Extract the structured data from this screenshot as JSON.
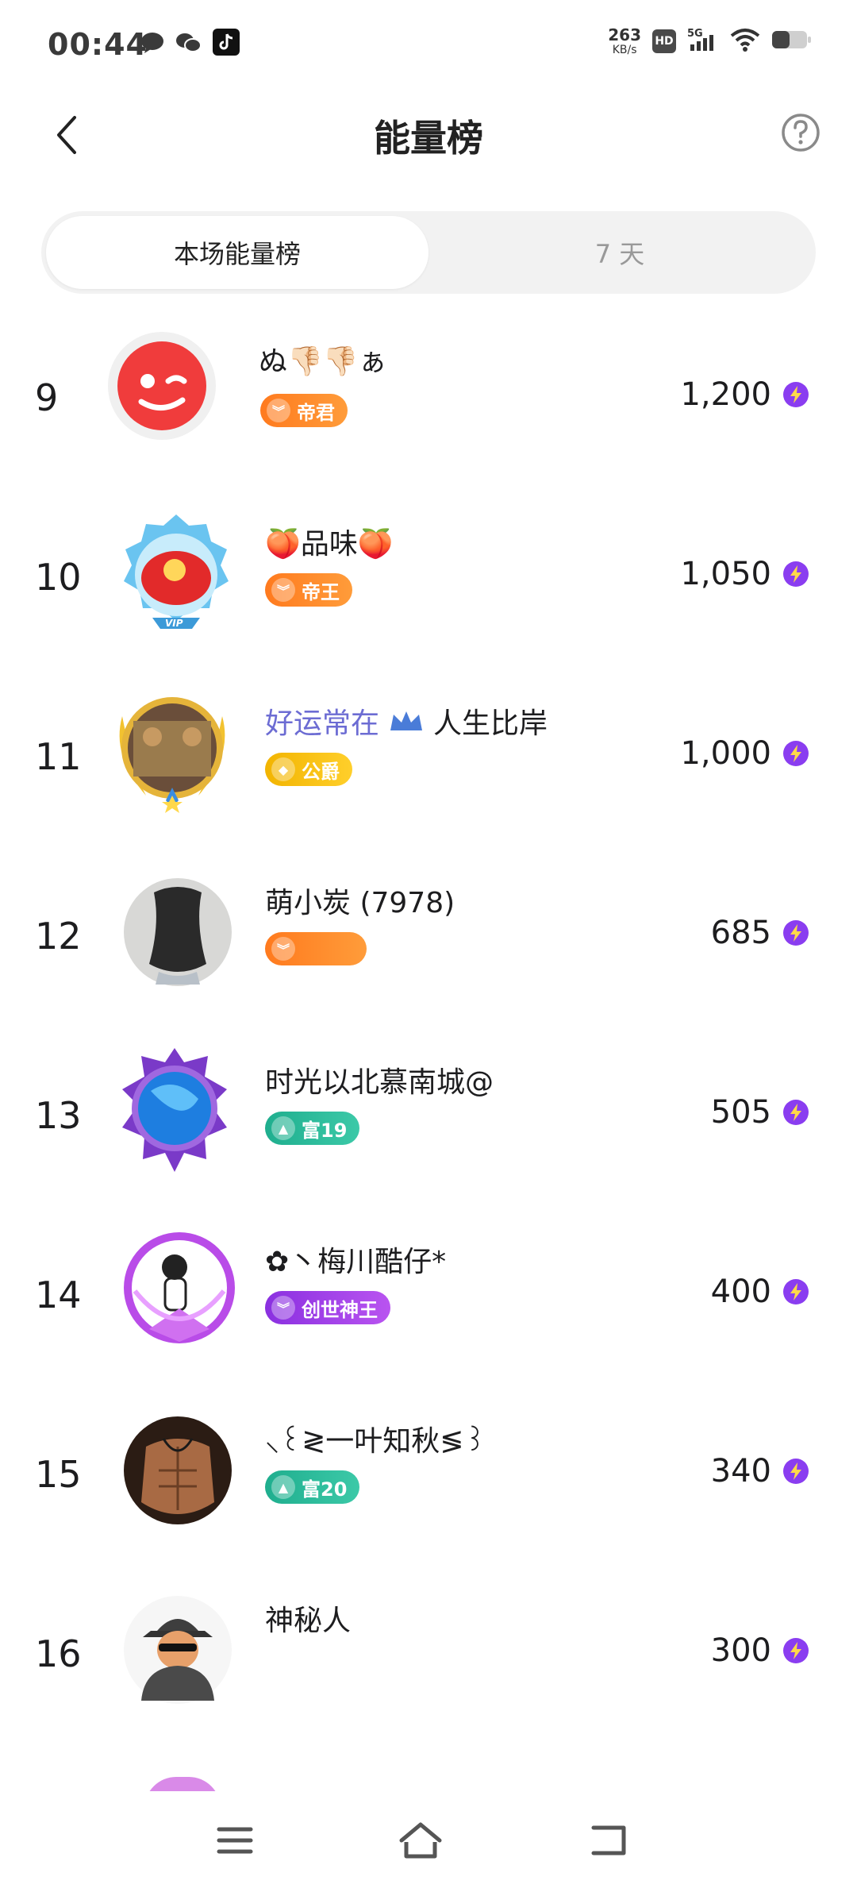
{
  "status_bar": {
    "time": "00:44",
    "net_speed_value": "263",
    "net_speed_unit": "KB/s",
    "hd": "HD",
    "network": "5G"
  },
  "header": {
    "title": "能量榜"
  },
  "tabs": [
    {
      "label": "本场能量榜",
      "active": true
    },
    {
      "label": "7 天",
      "active": false
    }
  ],
  "rankings": [
    {
      "rank": "9",
      "name": "ぬ👎🏻👎🏻ぁ",
      "badge": "帝君",
      "energy": "1,200"
    },
    {
      "rank": "10",
      "name": "🍑品味🍑",
      "badge": "帝王",
      "energy": "1,050"
    },
    {
      "rank": "11",
      "name_tag": "好运常在",
      "name": "人生比岸",
      "badge": "公爵",
      "energy": "1,000"
    },
    {
      "rank": "12",
      "name": "萌小炭 (7978)",
      "badge": "",
      "energy": "685"
    },
    {
      "rank": "13",
      "name": "时光以北慕南城@",
      "badge": "富19",
      "energy": "505"
    },
    {
      "rank": "14",
      "name": "✿丶梅川酷仔*",
      "badge": "创世神王",
      "energy": "400"
    },
    {
      "rank": "15",
      "name": "⸜꒰≷一叶知秋≶꒱",
      "badge": "富20",
      "energy": "340"
    },
    {
      "rank": "16",
      "name": "神秘人",
      "badge": "",
      "energy": "300"
    }
  ],
  "colors": {
    "energy_icon": "#8a3df0",
    "badge_orange": "#ff7a1e",
    "badge_gold": "#f2b400",
    "badge_teal": "#1fae8e",
    "badge_purple": "#8a30e0"
  }
}
